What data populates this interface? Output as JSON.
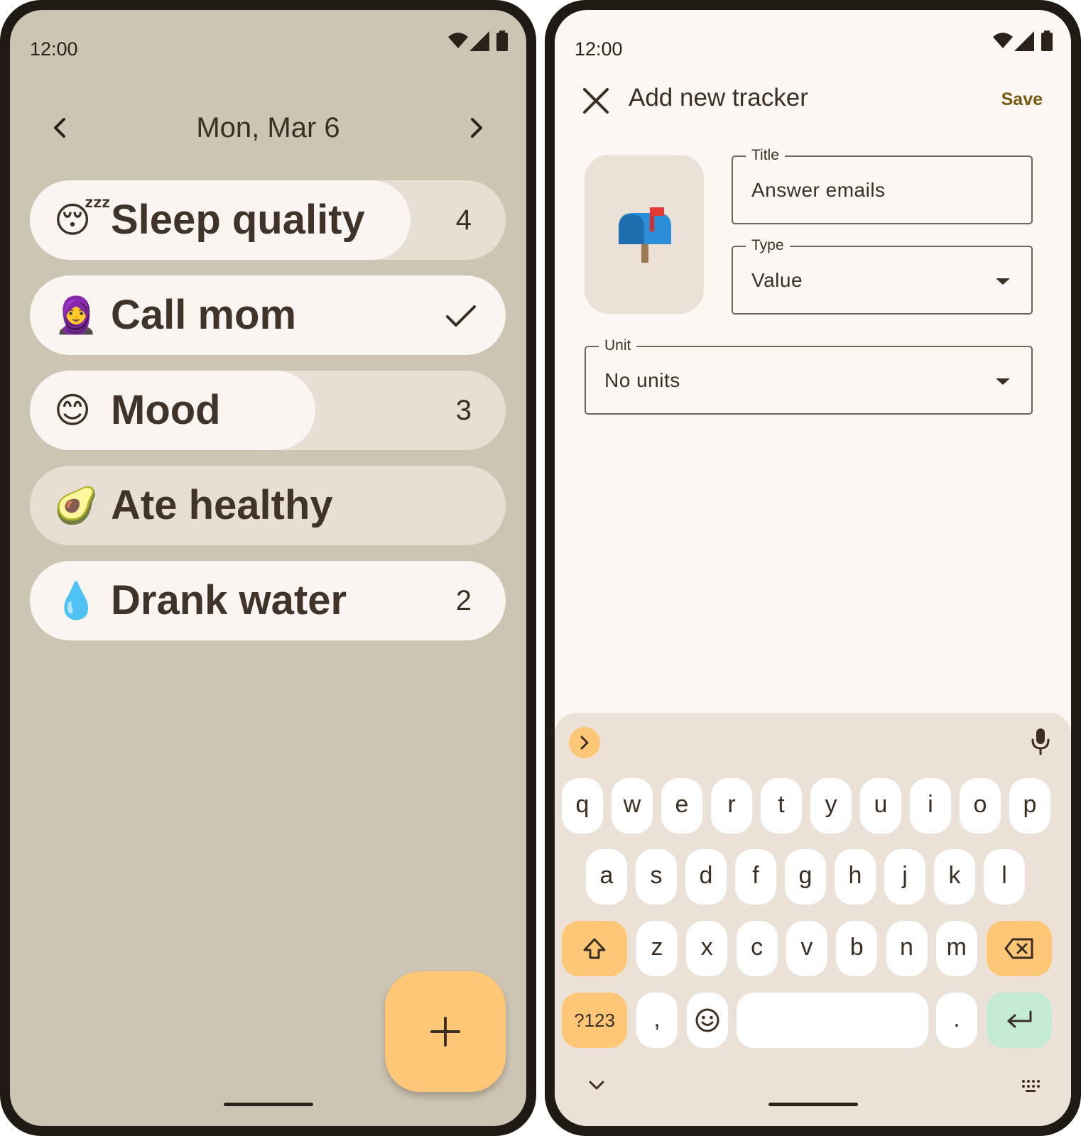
{
  "left_screen": {
    "status_time": "12:00",
    "date_title": "Mon, Mar 6",
    "trackers": [
      {
        "emoji": "😴",
        "label": "Sleep quality",
        "value": "4",
        "kind": "value",
        "fill_fraction": 0.8
      },
      {
        "emoji": "🧕",
        "label": "Call mom",
        "value": "",
        "kind": "check",
        "fill_fraction": 1.0
      },
      {
        "emoji": "😊",
        "label": "Mood",
        "value": "3",
        "kind": "value",
        "fill_fraction": 0.6
      },
      {
        "emoji": "🥑",
        "label": "Ate healthy",
        "value": "",
        "kind": "check",
        "fill_fraction": 0.0
      },
      {
        "emoji": "💧",
        "label": "Drank water",
        "value": "2",
        "kind": "value",
        "fill_fraction": 1.0
      }
    ],
    "icons": {
      "prev": "chevron-left-icon",
      "next": "chevron-right-icon",
      "fab": "plus-icon"
    }
  },
  "right_screen": {
    "status_time": "12:00",
    "dialog_title": "Add new tracker",
    "save_label": "Save",
    "selected_icon": "mailbox-icon",
    "title_field": {
      "label": "Title",
      "value": "Answer emails"
    },
    "type_field": {
      "label": "Type",
      "value": "Value"
    },
    "unit_field": {
      "label": "Unit",
      "value": "No units"
    },
    "keyboard": {
      "row1": [
        "q",
        "w",
        "e",
        "r",
        "t",
        "y",
        "u",
        "i",
        "o",
        "p"
      ],
      "row2": [
        "a",
        "s",
        "d",
        "f",
        "g",
        "h",
        "j",
        "k",
        "l"
      ],
      "row3": [
        "z",
        "x",
        "c",
        "v",
        "b",
        "n",
        "m"
      ],
      "symbols_label": "?123",
      "comma": ",",
      "period": "."
    }
  },
  "colors": {
    "left_background": "#cdc5b4",
    "right_background": "#fcf7f3",
    "accent_yellow": "#fec677",
    "enter_green": "#c3ead3",
    "keyboard_background": "#ebe1d6"
  }
}
